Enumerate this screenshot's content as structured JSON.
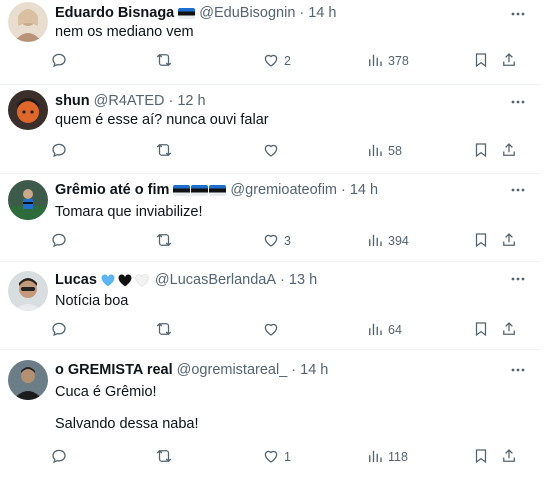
{
  "replies": [
    {
      "display_name": "Eduardo Bisnaga",
      "handle": "@EduBisognin",
      "time": "14 h",
      "badge": "flag",
      "text": [
        "nem os mediano vem"
      ],
      "replies_count": "",
      "retweets_count": "",
      "likes_count": "2",
      "views_count": "378"
    },
    {
      "display_name": "shun",
      "handle": "@R4ATED",
      "time": "12 h",
      "badge": "",
      "text": [
        "quem é esse aí? nunca ouvi falar"
      ],
      "replies_count": "",
      "retweets_count": "",
      "likes_count": "",
      "views_count": "58"
    },
    {
      "display_name": "Grêmio até o fim",
      "handle": "@gremioateofim",
      "time": "14 h",
      "badge": "flags3",
      "text": [
        "Tomara que inviabilize!"
      ],
      "replies_count": "",
      "retweets_count": "",
      "likes_count": "3",
      "views_count": "394"
    },
    {
      "display_name": "Lucas",
      "handle": "@LucasBerlandaA",
      "time": "13 h",
      "badge": "hearts",
      "text": [
        "Notícia boa"
      ],
      "replies_count": "",
      "retweets_count": "",
      "likes_count": "",
      "views_count": "64"
    },
    {
      "display_name": "o GREMISTA real",
      "handle": "@ogremistareal_",
      "time": "14 h",
      "badge": "",
      "text": [
        "Cuca é Grêmio!",
        "",
        "Salvando dessa naba!"
      ],
      "replies_count": "",
      "retweets_count": "",
      "likes_count": "1",
      "views_count": "118"
    }
  ],
  "separator": "·",
  "colors": {
    "text": "#0f1419",
    "secondary": "#536471",
    "divider": "#eff3f4",
    "heart_blue": "#5bb5f0",
    "heart_black": "#111111",
    "heart_white": "#f2f2f2"
  },
  "icons": [
    "reply-icon",
    "retweet-icon",
    "like-icon",
    "views-icon",
    "bookmark-icon",
    "share-icon",
    "more-icon"
  ]
}
